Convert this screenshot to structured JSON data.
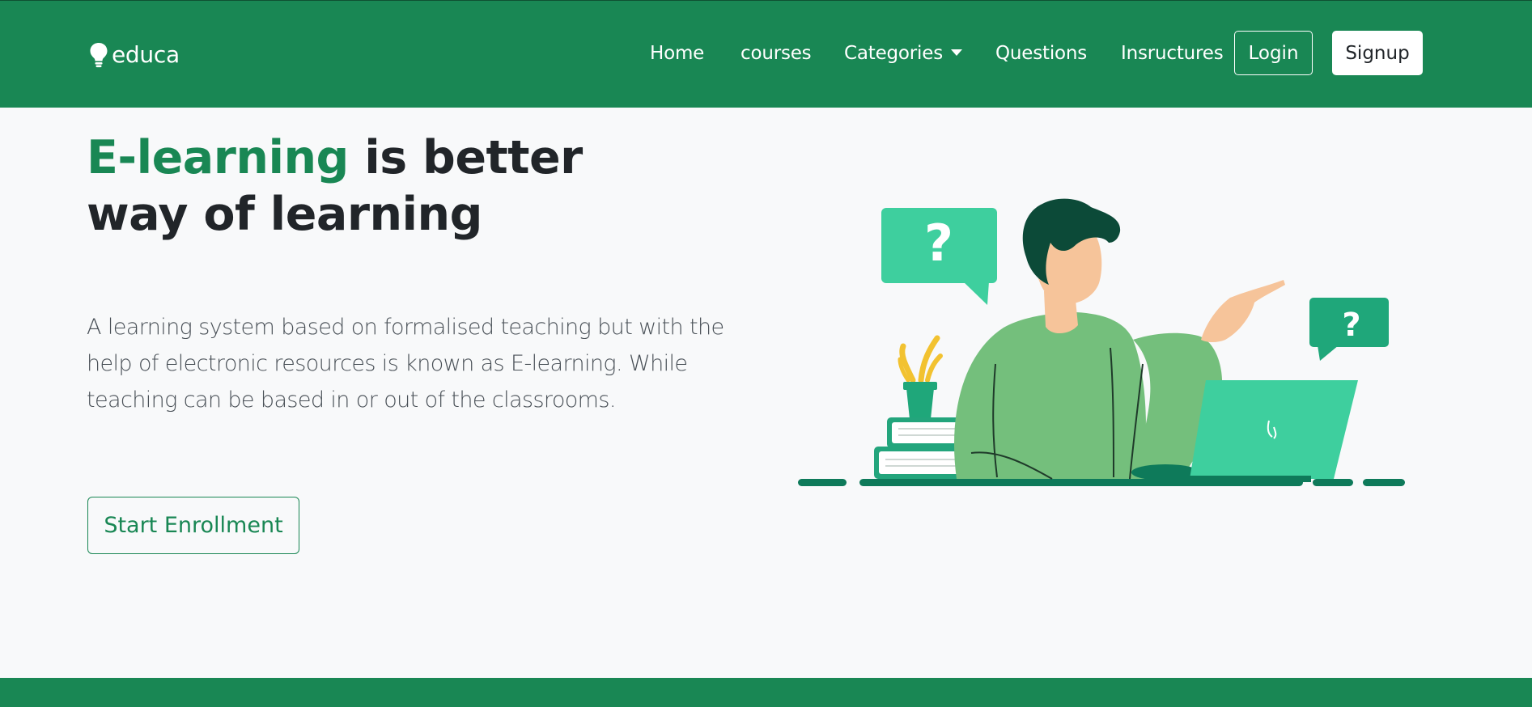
{
  "brand": {
    "name": "educa",
    "icon": "lightbulb-icon"
  },
  "nav": {
    "items": [
      {
        "label": "Home"
      },
      {
        "label": "courses"
      },
      {
        "label": "Categories"
      },
      {
        "label": "Questions"
      },
      {
        "label": "Insructures"
      }
    ],
    "login_label": "Login",
    "signup_label": "Signup"
  },
  "hero": {
    "title_accent": "E-learning",
    "title_line1_rest": " is better",
    "title_line2": "way of learning",
    "description": "A learning system based on formalised teaching but with the help of electronic resources is known as E-learning. While teaching can be based in or out of the classrooms.",
    "cta_label": "Start Enrollment",
    "bubble_left_text": "?",
    "bubble_right_text": "?"
  },
  "colors": {
    "primary": "#198754",
    "background": "#f8f9fa",
    "text_dark": "#212529",
    "illustration_teal": "#3ecf9e",
    "illustration_green": "#74bf7c"
  }
}
